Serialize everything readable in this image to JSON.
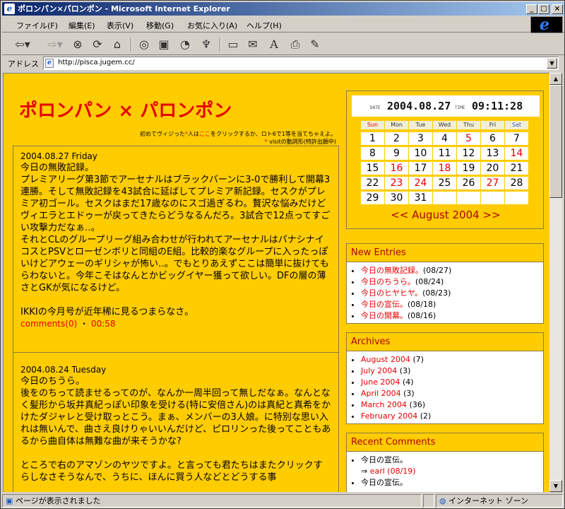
{
  "window": {
    "title": "ポロンパン×パロンポン - Microsoft Internet Explorer"
  },
  "menu": [
    "ファイル(F)",
    "編集(E)",
    "表示(V)",
    "移動(G)",
    "お気に入り(A)",
    "ヘルプ(H)"
  ],
  "address": {
    "label": "アドレス",
    "url": "http://pisca.jugem.cc/"
  },
  "status": {
    "text": "ページが表示されました",
    "zone": "インターネット ゾーン"
  },
  "blog": {
    "title": "ポロンパン × パロンポン",
    "notice1": "初めてヴィジった",
    "notice1_red": "*",
    "notice1b": "人は",
    "notice1_red2": "ここ",
    "notice1c": "をクリックするか、ロト6で1等を当てちゃえよ。",
    "notice2_red": "*",
    "notice2": " visitの動詞形(特許出願中)"
  },
  "entries": [
    {
      "date": "2004.08.27 Friday",
      "title": "今日の無敗記録。",
      "body": [
        "プレミアリーグ第3節でアーセナルはブラックバーンに3-0で勝利して開幕3連勝。そして無敗記録を43試合に延ばしてプレミア新記録。セスクがプレミア初ゴール。セスクはまだ17歳なのにスゴ過ぎるわ。贅沢な悩みだけどヴィエラとエドゥーが戻ってきたらどうなるんだろ。3試合で12点ってすごい攻撃力だなぁ‥。",
        "それとCLのグループリーグ組み合わせが行われてアーセナルはパナシナイコスとPSVとローゼンボリと同組のE組。比較的楽なグループに入ったっぽいけどアウェーのギリシャが怖い‥。でもとりあえずここは簡単に抜けてもらわないと。今年こそはなんとかビッグイヤー獲って欲しい。DFの層の薄さとGKが気になるけど。",
        "",
        "IKKIの今月号が近年稀に見るつまらなさ。"
      ],
      "comments": "comments(0)",
      "time": "00:58"
    },
    {
      "date": "2004.08.24 Tuesday",
      "title": "今日のちうら。",
      "body": [
        "後をのちって読ませるってのが、なんか一周半回って無しだなぁ。なんとなく髪形から坂井真紀っぽい印象を受ける(特に安倍さん)のは真紀と真希をかけたダジャレと受け取っとこう。まぁ、メンバーの3人娘。に特別な思い入れは無いんで、曲さえ良けりゃいいんだけど、ピロリンった後ってこともあるから曲自体は無難な曲が来そうかな?",
        "",
        "ところで右のアマゾンのヤツですよ。と言っても君たちはまたクリックすらしなさそうなんで、うちに、ほんに買う人などとどうする事"
      ]
    }
  ],
  "clock": {
    "date_label": "DATE",
    "date": "2004.08.27",
    "time_label": "TIME",
    "time": "09:11:28"
  },
  "calendar": {
    "dow": [
      "Sun",
      "Mon",
      "Tue",
      "Wed",
      "Thu",
      "Fri",
      "Sat"
    ],
    "days": [
      "1",
      "2",
      "3",
      "4",
      "5",
      "6",
      "7",
      "8",
      "9",
      "10",
      "11",
      "12",
      "13",
      "14",
      "15",
      "16",
      "17",
      "18",
      "19",
      "20",
      "21",
      "22",
      "23",
      "24",
      "25",
      "26",
      "27",
      "28",
      "29",
      "30",
      "31"
    ],
    "red_days": [
      "5",
      "14",
      "16",
      "18",
      "23",
      "24",
      "27"
    ],
    "nav_prev": "<<",
    "month": "August 2004",
    "nav_next": ">>"
  },
  "new_entries": {
    "title": "New Entries",
    "items": [
      {
        "label": "今日の無敗記録。",
        "date": "(08/27)"
      },
      {
        "label": "今日のちうら。",
        "date": "(08/24)"
      },
      {
        "label": "今日のヒヤヒヤ。",
        "date": "(08/23)"
      },
      {
        "label": "今日の宣伝。",
        "date": "(08/18)"
      },
      {
        "label": "今日の開幕。",
        "date": "(08/16)"
      }
    ]
  },
  "archives": {
    "title": "Archives",
    "items": [
      {
        "label": "August 2004",
        "count": "(7)"
      },
      {
        "label": "July 2004",
        "count": "(3)"
      },
      {
        "label": "June 2004",
        "count": "(4)"
      },
      {
        "label": "April 2004",
        "count": "(3)"
      },
      {
        "label": "March 2004",
        "count": "(36)"
      },
      {
        "label": "February 2004",
        "count": "(2)"
      }
    ]
  },
  "recent_comments": {
    "title": "Recent Comments",
    "items": [
      {
        "entry": "今日の宣伝。",
        "arrow": "⇒",
        "by": "earl (08/19)"
      },
      {
        "entry": "今日の宣伝。",
        "arrow": "",
        "by": ""
      }
    ]
  },
  "colors": {
    "page_bg": "#ffcc00",
    "accent_red": "#e60000",
    "link_red": "#b00000",
    "title_bar": "#0a246a"
  }
}
